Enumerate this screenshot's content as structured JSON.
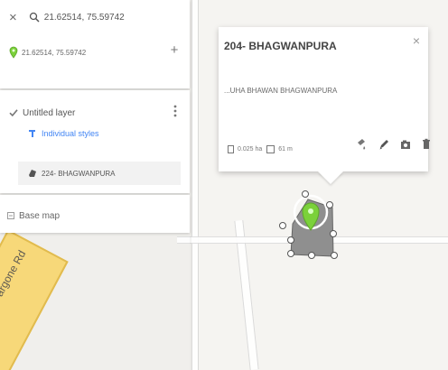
{
  "search": {
    "close_label": "×",
    "query": "21.62514, 75.59742",
    "result_label": "21.62514, 75.59742",
    "add_label": "+"
  },
  "layers": {
    "layer_name": "Untitled layer",
    "styles_label": "Individual styles",
    "feature_label": "224- BHAGWANPURA",
    "base_map_label": "Base map"
  },
  "popup": {
    "title": "204- BHAGWANPURA",
    "description": "...UHA BHAWAN BHAGWANPURA",
    "area": "0.025 ha",
    "perimeter": "61 m",
    "close_label": "×"
  },
  "map": {
    "road_label": "argone Rd"
  },
  "colors": {
    "accent_blue": "#4285f4",
    "marker_green": "#7bd13a",
    "polygon_fill": "#8f8f8f",
    "road_yellow": "#f7d879"
  },
  "icons": {
    "search": "search-icon",
    "close": "close-icon",
    "pin": "map-pin-icon",
    "add": "add-icon",
    "checkbox": "checkbox-icon",
    "more": "more-vertical-icon",
    "paint": "paint-icon",
    "polygon": "polygon-icon",
    "base_map": "base-map-icon",
    "style": "style-icon",
    "edit": "edit-icon",
    "camera": "camera-icon",
    "delete": "delete-icon"
  }
}
